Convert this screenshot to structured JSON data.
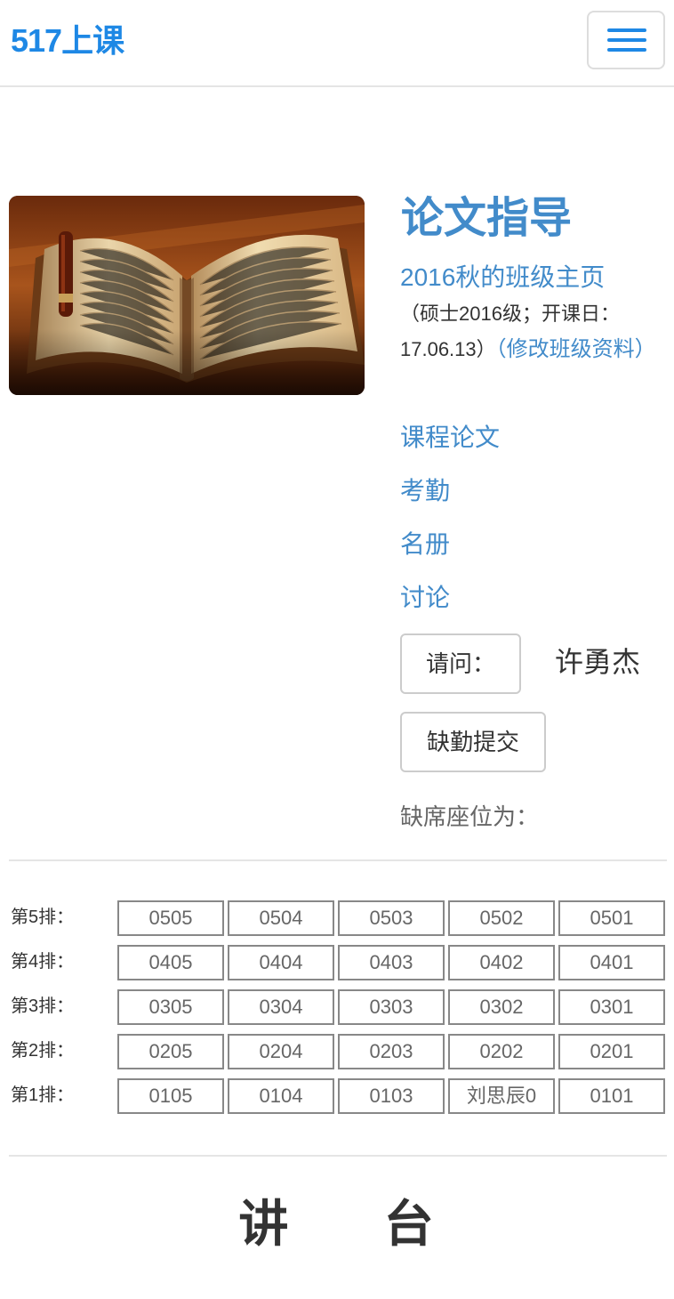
{
  "navbar": {
    "brand": "517上课",
    "menu_icon": "hamburger-menu-icon"
  },
  "course": {
    "image_icon": "open-book-image",
    "title": "论文指导",
    "class_home_link": "2016秋的班级主页",
    "class_info_text": "（硕士2016级；开课日：17.06.13）",
    "edit_link": "（修改班级资料）",
    "links": [
      "课程论文",
      "考勤",
      "名册",
      "讨论"
    ]
  },
  "actions": {
    "ask_button": "请问：",
    "student_name": "许勇杰",
    "absent_submit_button": "缺勤提交",
    "absent_seat_label": "缺席座位为："
  },
  "seating": {
    "rows": [
      {
        "label": "第5排：",
        "seats": [
          "0505",
          "0504",
          "0503",
          "0502",
          "0501"
        ]
      },
      {
        "label": "第4排：",
        "seats": [
          "0405",
          "0404",
          "0403",
          "0402",
          "0401"
        ]
      },
      {
        "label": "第3排：",
        "seats": [
          "0305",
          "0304",
          "0303",
          "0302",
          "0301"
        ]
      },
      {
        "label": "第2排：",
        "seats": [
          "0205",
          "0204",
          "0203",
          "0202",
          "0201"
        ]
      },
      {
        "label": "第1排：",
        "seats": [
          "0105",
          "0104",
          "0103",
          "刘思辰0",
          "0101"
        ]
      }
    ],
    "podium": "讲      台"
  }
}
